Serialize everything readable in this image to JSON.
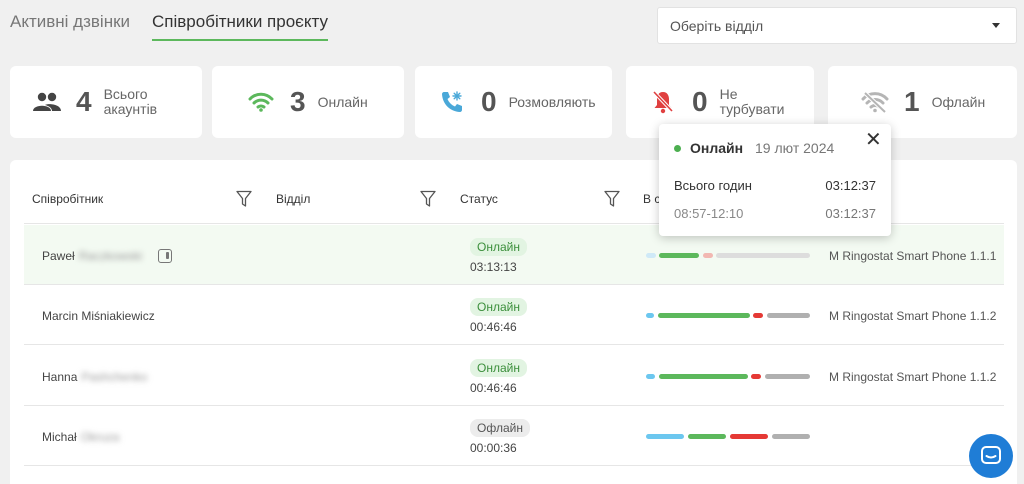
{
  "tabs": [
    {
      "label": "Активні дзвінки"
    },
    {
      "label": "Співробітники проєкту"
    }
  ],
  "department_select": {
    "placeholder": "Оберіть відділ"
  },
  "stats": [
    {
      "value": "4",
      "label_line1": "Всього",
      "label_line2": "акаунтів",
      "icon": "people-icon",
      "color": "#444444"
    },
    {
      "value": "3",
      "label_line1": "Онлайн",
      "label_line2": "",
      "icon": "wifi-icon",
      "color": "#5cb85c"
    },
    {
      "value": "0",
      "label_line1": "Розмовляють",
      "label_line2": "",
      "icon": "phone-call-icon",
      "color": "#4aa8d8"
    },
    {
      "value": "0",
      "label_line1": "Не",
      "label_line2": "турбувати",
      "icon": "bell-off-icon",
      "color": "#e04040"
    },
    {
      "value": "1",
      "label_line1": "Офлайн",
      "label_line2": "",
      "icon": "wifi-off-icon",
      "color": "#aaaaaa"
    }
  ],
  "table": {
    "headers": {
      "employee": "Співробітник",
      "department": "Відділ",
      "status": "Статус",
      "time": "В с"
    },
    "rows": [
      {
        "first": "Paweł",
        "last": "Raczkowski",
        "status": "Онлайн",
        "duration": "03:13:13",
        "device": "M Ringostat Smart Phone 1.1.1"
      },
      {
        "first": "Marcin Miśniakiewicz",
        "last": "",
        "status": "Онлайн",
        "duration": "00:46:46",
        "device": "M Ringostat Smart Phone 1.1.2"
      },
      {
        "first": "Hanna",
        "last": "Pashchenko",
        "status": "Онлайн",
        "duration": "00:46:46",
        "device": "M Ringostat Smart Phone 1.1.2"
      },
      {
        "first": "Michał",
        "last": "Okruza",
        "status": "Офлайн",
        "duration": "00:00:36",
        "device": ""
      }
    ]
  },
  "popup": {
    "status": "Онлайн",
    "date": "19 лют 2024",
    "total_label": "Всього годин",
    "total_value": "03:12:37",
    "interval_label": "08:57-12:10",
    "interval_value": "03:12:37"
  },
  "colors": {
    "accent": "#5cb85c",
    "online_badge_bg": "#e2f4e2",
    "offline_badge_bg": "#ececec",
    "bar_talk": "#6cc7ef",
    "bar_online": "#5cb85c",
    "bar_dnd": "#e53935",
    "bar_offline": "#b0b0b0",
    "chat_button": "#1f7dd6"
  }
}
